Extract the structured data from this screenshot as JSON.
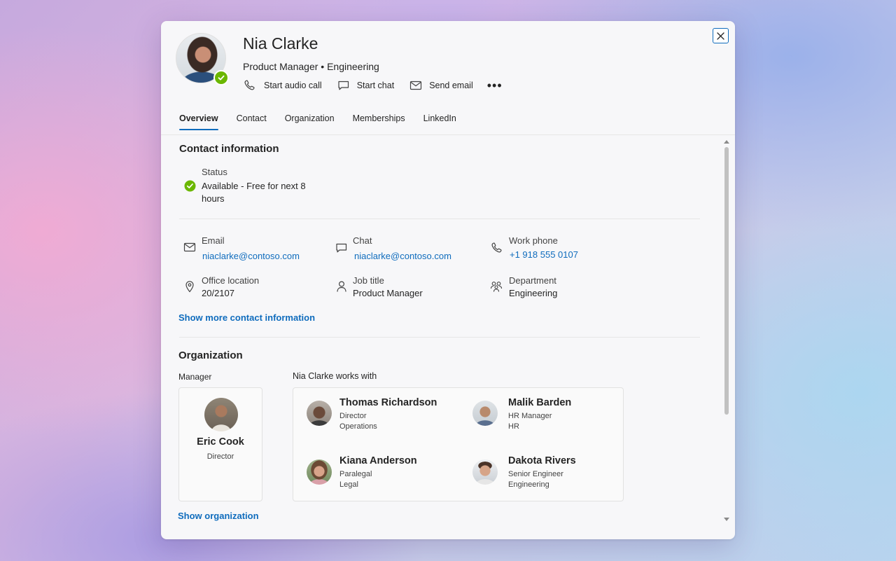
{
  "profile": {
    "name": "Nia Clarke",
    "subtitle": "Product Manager • Engineering",
    "presence_color": "#6bb700"
  },
  "actions": [
    {
      "label": "Start audio call",
      "icon": "phone-icon"
    },
    {
      "label": "Start chat",
      "icon": "chat-icon"
    },
    {
      "label": "Send email",
      "icon": "mail-icon"
    }
  ],
  "more_label": "•••",
  "tabs": [
    "Overview",
    "Contact",
    "Organization",
    "Memberships",
    "LinkedIn"
  ],
  "active_tab": "Overview",
  "contact": {
    "title": "Contact information",
    "status_label": "Status",
    "status_value_line1": "Available - Free for next 8",
    "status_value_line2": "hours",
    "email_label": "Email",
    "email_value": "niaclarke@contoso.com",
    "chat_label": "Chat",
    "chat_value": "niaclarke@contoso.com",
    "phone_label": "Work phone",
    "phone_value": "+1 918 555 0107",
    "office_label": "Office location",
    "office_value": "20/2107",
    "job_label": "Job title",
    "job_value": "Product Manager",
    "dept_label": "Department",
    "dept_value": "Engineering",
    "show_more": "Show more contact information"
  },
  "organization": {
    "title": "Organization",
    "manager_label": "Manager",
    "manager": {
      "name": "Eric Cook",
      "title": "Director"
    },
    "works_with_label": "Nia Clarke works with",
    "peers": [
      {
        "name": "Thomas Richardson",
        "title": "Director",
        "department": "Operations"
      },
      {
        "name": "Malik Barden",
        "title": "HR Manager",
        "department": "HR"
      },
      {
        "name": "Kiana Anderson",
        "title": "Paralegal",
        "department": "Legal"
      },
      {
        "name": "Dakota Rivers",
        "title": "Senior Engineer",
        "department": "Engineering"
      }
    ],
    "show_org": "Show organization"
  },
  "colors": {
    "accent": "#0f6cbd",
    "available": "#6bb700"
  }
}
